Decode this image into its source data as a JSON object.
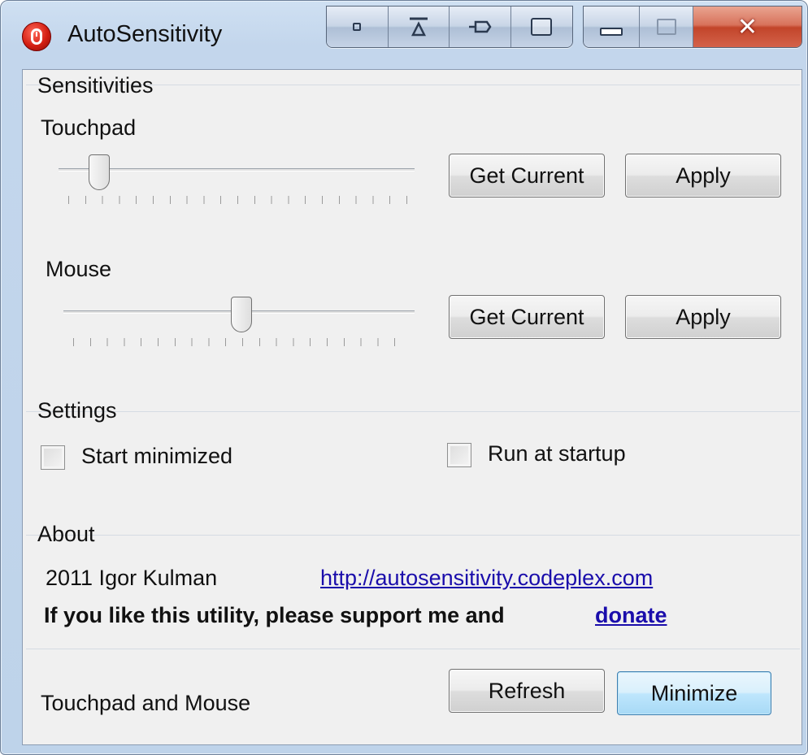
{
  "window": {
    "title": "AutoSensitivity"
  },
  "sensitivities": {
    "group_label": "Sensitivities",
    "touchpad": {
      "label": "Touchpad",
      "level": 0.07,
      "get_current_label": "Get Current",
      "apply_label": "Apply"
    },
    "mouse": {
      "label": "Mouse",
      "level": 0.5,
      "get_current_label": "Get Current",
      "apply_label": "Apply"
    }
  },
  "settings": {
    "group_label": "Settings",
    "start_minimized": {
      "label": "Start minimized",
      "checked": false
    },
    "run_at_startup": {
      "label": "Run at startup",
      "checked": false
    }
  },
  "about": {
    "group_label": "About",
    "copyright": "2011 Igor Kulman",
    "url": "http://autosensitivity.codeplex.com",
    "support_text": "If you like this utility, please support me and",
    "donate_label": "donate"
  },
  "footer": {
    "status": "Touchpad and Mouse",
    "refresh_label": "Refresh",
    "minimize_label": "Minimize"
  },
  "icons": [
    "app-mouse-icon",
    "caption-dot-icon",
    "caption-pin-icon",
    "caption-pushpin-icon",
    "caption-window-icon",
    "minimize-icon",
    "maximize-icon",
    "close-icon"
  ]
}
